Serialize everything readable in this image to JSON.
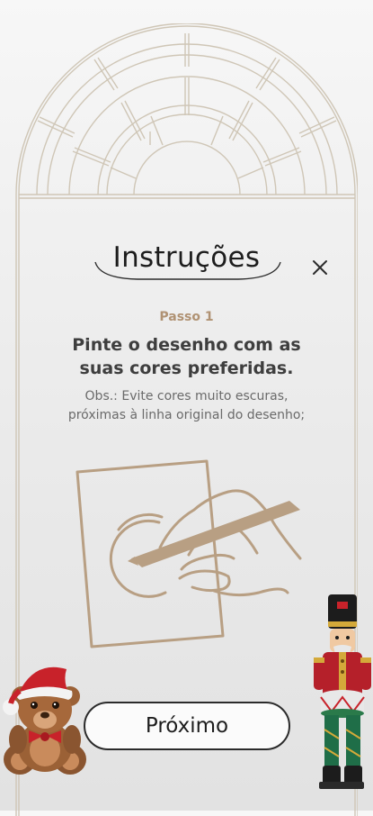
{
  "modal": {
    "title": "Instruções",
    "close_icon": "close-icon",
    "step": {
      "label": "Passo 1",
      "heading_line1": "Pinte o desenho com as",
      "heading_line2": "suas cores preferidas.",
      "note_line1": "Obs.: Evite cores muito escuras,",
      "note_line2": "próximas à linha original do desenho;"
    },
    "illustration_icon": "hand-drawing-icon",
    "next_button_label": "Próximo"
  },
  "decorations": {
    "window_arch": "arched-window-frame",
    "left_character": "teddy-bear-santa-hat-icon",
    "right_character": "nutcracker-soldier-icon"
  },
  "colors": {
    "accent": "#b09273",
    "frame_line": "#cfc6b6",
    "text_dark": "#1d1d1d",
    "text_muted": "#6a6a6a"
  }
}
